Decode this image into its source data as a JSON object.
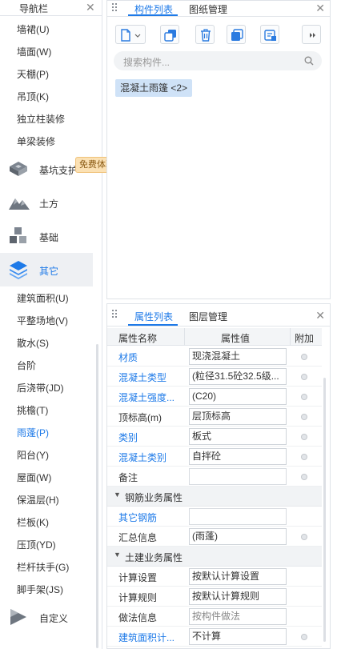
{
  "nav": {
    "title": "导航栏",
    "items": [
      {
        "label": "墙裙(U)"
      },
      {
        "label": "墙面(W)"
      },
      {
        "label": "天棚(P)"
      },
      {
        "label": "吊顶(K)"
      },
      {
        "label": "独立柱装修"
      },
      {
        "label": "单梁装修"
      }
    ],
    "categories": [
      {
        "label": "基坑支护",
        "icon": "foundation-pit-icon"
      },
      {
        "label": "土方",
        "icon": "earthwork-icon"
      },
      {
        "label": "基础",
        "icon": "foundation-icon"
      },
      {
        "label": "其它",
        "icon": "layers-icon",
        "selected": true
      },
      {
        "label": "自定义",
        "icon": "custom-icon"
      }
    ],
    "promo_badge": "免费体验",
    "sub_items": [
      {
        "label": "建筑面积(U)"
      },
      {
        "label": "平整场地(V)"
      },
      {
        "label": "散水(S)"
      },
      {
        "label": "台阶"
      },
      {
        "label": "后浇带(JD)"
      },
      {
        "label": "挑檐(T)"
      },
      {
        "label": "雨蓬(P)",
        "active": true
      },
      {
        "label": "阳台(Y)"
      },
      {
        "label": "屋面(W)"
      },
      {
        "label": "保温层(H)"
      },
      {
        "label": "栏板(K)"
      },
      {
        "label": "压顶(YD)"
      },
      {
        "label": "栏杆扶手(G)"
      },
      {
        "label": "脚手架(JS)"
      }
    ]
  },
  "component_panel": {
    "tabs": [
      {
        "label": "构件列表",
        "active": true
      },
      {
        "label": "图纸管理"
      }
    ],
    "toolbar": [
      "new-component-icon",
      "copy-icon",
      "delete-icon",
      "layer-copy-icon",
      "filter-icon",
      "more-icon"
    ],
    "search_placeholder": "搜索构件...",
    "items": [
      {
        "label": "混凝土雨篷 <2>"
      }
    ]
  },
  "property_panel": {
    "tabs": [
      {
        "label": "属性列表",
        "active": true
      },
      {
        "label": "图层管理"
      }
    ],
    "columns": {
      "name": "属性名称",
      "value": "属性值",
      "extra": "附加"
    },
    "rows_top": [
      {
        "name": "材质",
        "value": "现浇混凝土",
        "link": true,
        "dot": true
      },
      {
        "name": "混凝土类型",
        "value": "(粒径31.5砼32.5级...",
        "link": true,
        "dot": true
      },
      {
        "name": "混凝土强度...",
        "value": "(C20)",
        "link": true,
        "dot": true
      },
      {
        "name": "顶标高(m)",
        "value": "层顶标高",
        "link": false,
        "dot": true
      },
      {
        "name": "类别",
        "value": "板式",
        "link": true,
        "dot": true
      },
      {
        "name": "混凝土类别",
        "value": "自拌砼",
        "link": true,
        "dot": true
      },
      {
        "name": "备注",
        "value": "",
        "link": false,
        "dot": true
      }
    ],
    "section_rebar": "钢筋业务属性",
    "rows_rebar": [
      {
        "name": "其它钢筋",
        "value": "",
        "link": true,
        "dot": false
      },
      {
        "name": "汇总信息",
        "value": "(雨蓬)",
        "link": false,
        "dot": true
      }
    ],
    "section_civil": "土建业务属性",
    "rows_civil": [
      {
        "name": "计算设置",
        "value": "按默认计算设置",
        "link": false,
        "dot": false
      },
      {
        "name": "计算规则",
        "value": "按默认计算规则",
        "link": false,
        "dot": false
      },
      {
        "name": "做法信息",
        "value": "按构件做法",
        "link": false,
        "dot": false,
        "muted": true
      },
      {
        "name": "建筑面积计...",
        "value": "不计算",
        "link": true,
        "dot": true
      }
    ]
  }
}
